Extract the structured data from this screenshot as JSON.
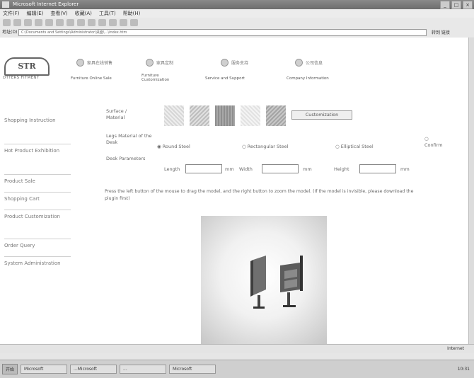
{
  "browser": {
    "window_title": "Microsoft Internet Explorer",
    "menu": [
      "文件(F)",
      "编辑(E)",
      "查看(V)",
      "收藏(A)",
      "工具(T)",
      "帮助(H)"
    ],
    "address_label": "地址(D)",
    "address_value": "C:\\Documents and Settings\\Administrator\\桌面\\...\\index.htm",
    "go_label": "转到 链接",
    "status_zone": "Internet",
    "taskbar": {
      "start": "开始",
      "tasks": [
        "Microsoft",
        "...Microsoft",
        "...",
        "Microsoft"
      ],
      "clock": "10:31"
    }
  },
  "site": {
    "logo": "STR",
    "logo_sub": "DTTERS FITMENT",
    "nav": [
      {
        "zh": "家具在线销售",
        "en": "Furniture Online Sale"
      },
      {
        "zh": "家具定制",
        "en": "Furniture Customization"
      },
      {
        "zh": "服务支持",
        "en": "Service and Support"
      },
      {
        "zh": "公司信息",
        "en": "Company Information"
      }
    ]
  },
  "sidebar": [
    "Shopping Instruction",
    "Hot Product Exhibition",
    "Product Sale",
    "Shopping Cart",
    "Product Customization",
    "Order Query",
    "System Administration"
  ],
  "form": {
    "surface_label": "Surface / Material",
    "customization_button": "Customization",
    "legs_label": "Legs Material of the Desk",
    "leg_options": [
      "Round Steel",
      "Rectangular Steel",
      "Elliptical Steel"
    ],
    "selected_leg": "Round Steel",
    "confirm_label": "Confirm",
    "params_label": "Desk Parameters",
    "length_label": "Length",
    "width_label": "Width",
    "height_label": "Height",
    "unit": "mm",
    "length_value": "",
    "width_value": "",
    "height_value": ""
  },
  "instruction": "Press the left button of the mouse to drag the model, and the right button to zoom the model. (If the model is invisible, please download the plugin first)"
}
